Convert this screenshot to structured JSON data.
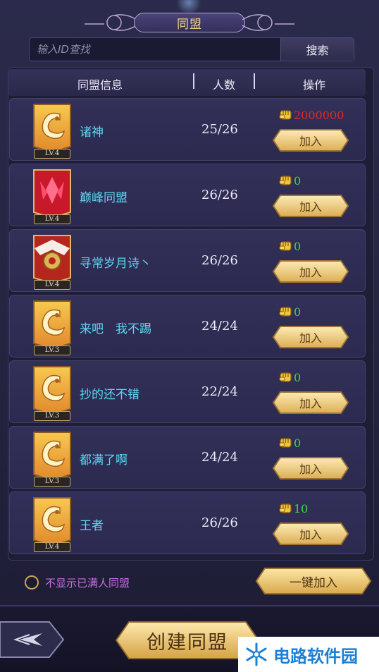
{
  "title": "同盟",
  "search": {
    "placeholder": "输入ID查找",
    "button_label": "搜索"
  },
  "table": {
    "headers": [
      "同盟信息",
      "人数",
      "操作"
    ],
    "join_label": "加入",
    "rows": [
      {
        "level": "LV.4",
        "name": "诸神",
        "count": "25/26",
        "power": "2000000",
        "power_color": "#e02828",
        "banner": "gold"
      },
      {
        "level": "LV.4",
        "name": "巅峰同盟",
        "count": "26/26",
        "power": "0",
        "power_color": "#3bd84a",
        "banner": "red"
      },
      {
        "level": "LV.4",
        "name": "寻常岁月诗丶",
        "count": "26/26",
        "power": "0",
        "power_color": "#3bd84a",
        "banner": "wings"
      },
      {
        "level": "LV.3",
        "name": "来吧　我不踢",
        "count": "24/24",
        "power": "0",
        "power_color": "#3bd84a",
        "banner": "gold"
      },
      {
        "level": "LV.3",
        "name": "抄的还不错",
        "count": "22/24",
        "power": "0",
        "power_color": "#3bd84a",
        "banner": "gold"
      },
      {
        "level": "LV.3",
        "name": "都满了啊",
        "count": "24/24",
        "power": "0",
        "power_color": "#3bd84a",
        "banner": "gold"
      },
      {
        "level": "LV.4",
        "name": "王者",
        "count": "26/26",
        "power": "10",
        "power_color": "#3bd84a",
        "banner": "gold"
      }
    ]
  },
  "options": {
    "hide_full_label": "不显示已满人同盟",
    "one_key_join_label": "一键加入"
  },
  "footer": {
    "create_label": "创建同盟",
    "watermark_text": "电路软件园"
  },
  "icons": {
    "power": "fist-icon",
    "back": "back-arrow-icon",
    "watermark_logo": "snowflake-logo"
  },
  "colors": {
    "guild_name": "#5bd7f0",
    "gold_button": "#f2d27a",
    "option_text": "#c46ee0"
  }
}
